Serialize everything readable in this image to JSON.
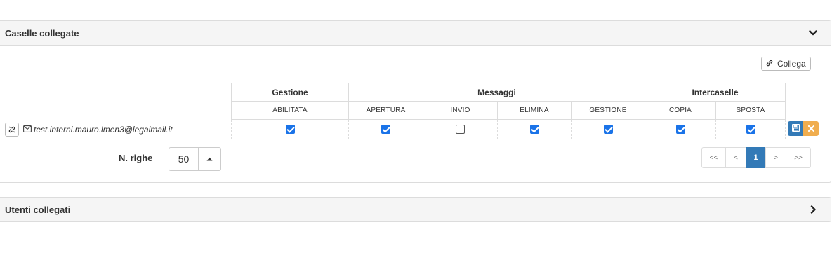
{
  "linked_boxes_panel": {
    "title": "Caselle collegate",
    "collega_label": "Collega",
    "group_headers": [
      "Gestione",
      "Messaggi",
      "Intercaselle"
    ],
    "sub_headers": [
      "ABILITATA",
      "APERTURA",
      "INVIO",
      "ELIMINA",
      "GESTIONE",
      "COPIA",
      "SPOSTA"
    ],
    "row": {
      "email": "test.interni.mauro.lmen3@legalmail.it",
      "checks": [
        true,
        true,
        false,
        true,
        true,
        true,
        true
      ]
    },
    "rows_per_page_label": "N. righe",
    "rows_per_page_value": "50",
    "pagination": [
      "<<",
      "<",
      "1",
      ">",
      ">>"
    ],
    "active_page": "1"
  },
  "linked_users_panel": {
    "title": "Utenti collegati"
  },
  "colors": {
    "primary": "#337ab7",
    "warning": "#f0ad4e",
    "checkbox": "#1a73e8",
    "panel_header_bg": "#f5f5f5"
  }
}
